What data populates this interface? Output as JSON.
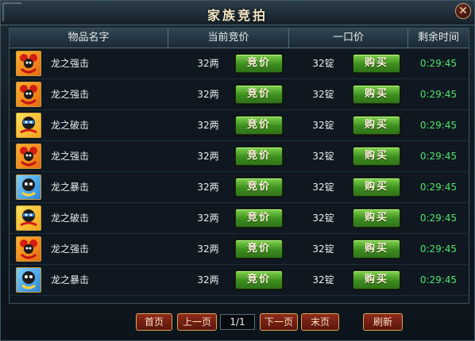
{
  "window": {
    "title": "家族竞拍",
    "close_label": "✕"
  },
  "table": {
    "headers": {
      "item_name": "物品名字",
      "current_bid": "当前竞价",
      "buyout": "一口价",
      "time_left": "剩余时间"
    },
    "bid_label": "竞价",
    "buy_label": "购买",
    "rows": [
      {
        "icon": "red-dragon-icon",
        "name": "龙之强击",
        "bid": "32两",
        "buyout": "32锭",
        "time": "0:29:45"
      },
      {
        "icon": "red-dragon-icon",
        "name": "龙之强击",
        "bid": "32两",
        "buyout": "32锭",
        "time": "0:29:45"
      },
      {
        "icon": "yellow-dragon-icon",
        "name": "龙之破击",
        "bid": "32两",
        "buyout": "32锭",
        "time": "0:29:45"
      },
      {
        "icon": "red-dragon-icon",
        "name": "龙之强击",
        "bid": "32两",
        "buyout": "32锭",
        "time": "0:29:45"
      },
      {
        "icon": "blue-dragon-icon",
        "name": "龙之暴击",
        "bid": "32两",
        "buyout": "32锭",
        "time": "0:29:45"
      },
      {
        "icon": "yellow-dragon-icon",
        "name": "龙之破击",
        "bid": "32两",
        "buyout": "32锭",
        "time": "0:29:45"
      },
      {
        "icon": "red-dragon-icon",
        "name": "龙之强击",
        "bid": "32两",
        "buyout": "32锭",
        "time": "0:29:45"
      },
      {
        "icon": "blue-dragon-icon",
        "name": "龙之暴击",
        "bid": "32两",
        "buyout": "32锭",
        "time": "0:29:45"
      }
    ]
  },
  "pager": {
    "first": "首页",
    "prev": "上一页",
    "page": "1/1",
    "next": "下一页",
    "last": "末页",
    "refresh": "刷新"
  },
  "colors": {
    "time_text": "#4ee26a",
    "button_green": "#3c8e1f",
    "button_red": "#8e2c1a"
  }
}
